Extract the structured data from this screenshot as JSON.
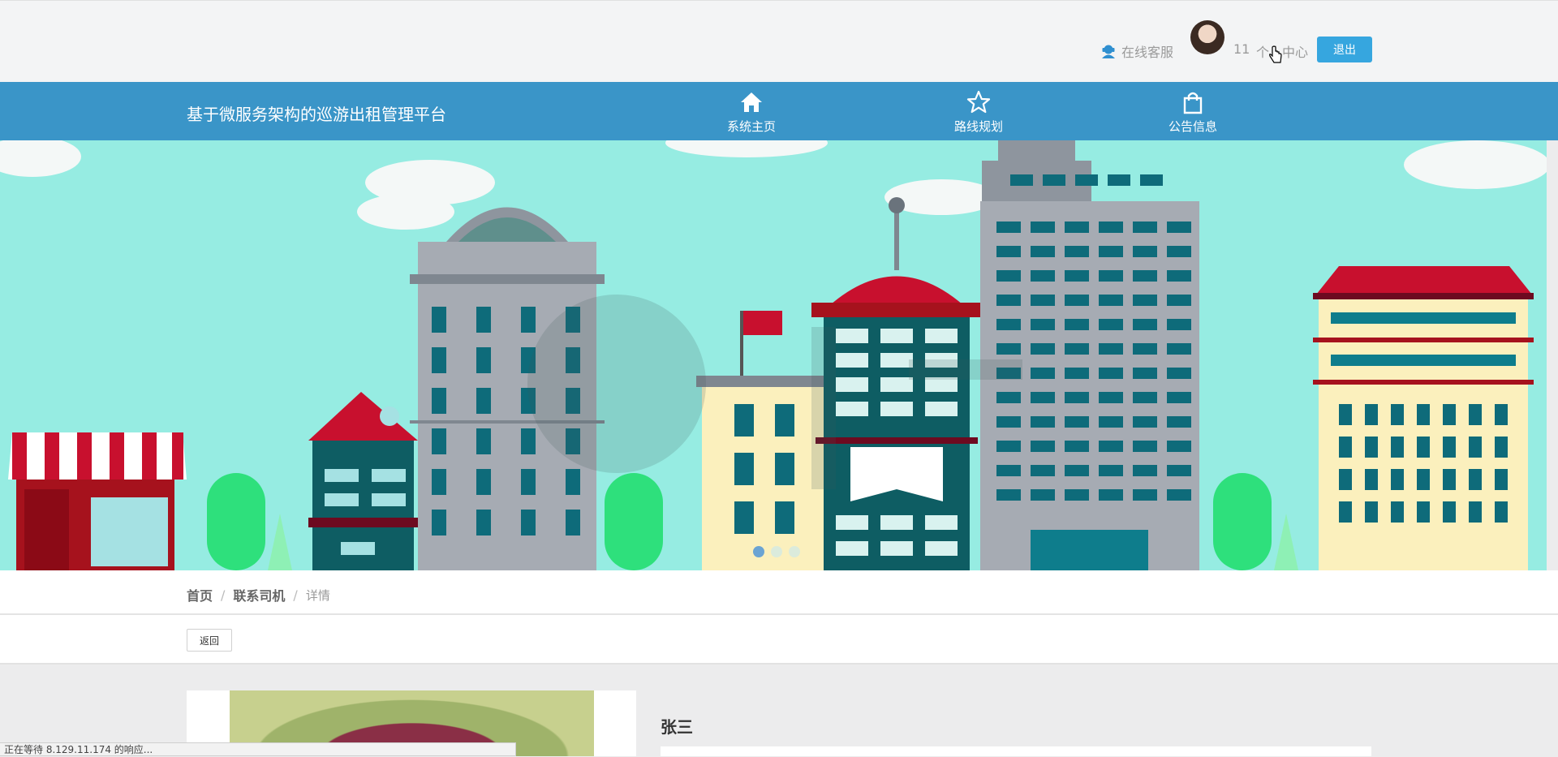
{
  "topbar": {
    "service_label": "在线客服",
    "username": "11",
    "user_center_label": "个人中心",
    "logout_label": "退出"
  },
  "nav": {
    "brand": "基于微服务架构的巡游出租管理平台",
    "items": [
      {
        "label": "系统主页",
        "icon": "home-icon"
      },
      {
        "label": "路线规划",
        "icon": "star-icon"
      },
      {
        "label": "公告信息",
        "icon": "shopping-bag-icon"
      }
    ]
  },
  "banner": {
    "slide_count": 3,
    "active_slide": 1
  },
  "breadcrumb": {
    "items": [
      "首页",
      "联系司机"
    ],
    "current": "详情"
  },
  "actions": {
    "back_label": "返回"
  },
  "detail": {
    "name": "张三"
  },
  "status_bar": {
    "text": "正在等待 8.129.11.174 的响应..."
  },
  "colors": {
    "nav_bg": "#3a95c8",
    "accent_button": "#36a6df",
    "banner_sky": "#96ece2"
  }
}
